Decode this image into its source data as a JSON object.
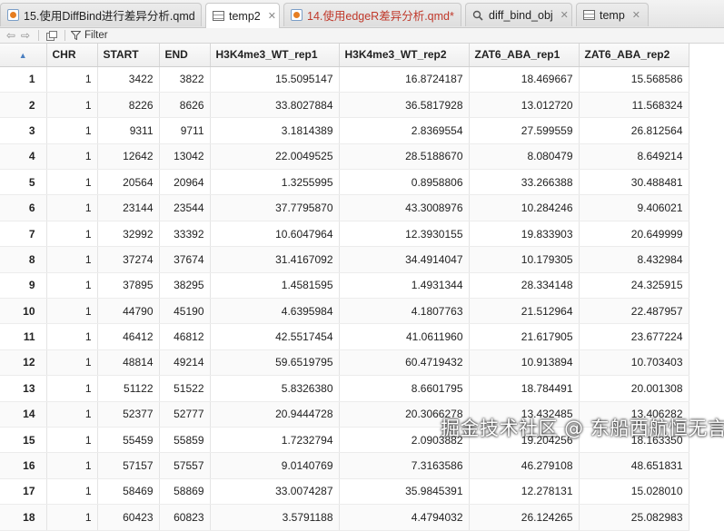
{
  "tabs": [
    {
      "label": "15.使用DiffBind进行差异分析.qmd",
      "icon": "r-doc-icon",
      "active": false,
      "modified": false
    },
    {
      "label": "temp2",
      "icon": "table-icon",
      "active": true,
      "modified": false
    },
    {
      "label": "14.使用edgeR差异分析.qmd*",
      "icon": "r-doc-icon",
      "active": false,
      "modified": true
    },
    {
      "label": "diff_bind_obj",
      "icon": "magnifier-icon",
      "active": false,
      "modified": false
    },
    {
      "label": "temp",
      "icon": "table-icon",
      "active": false,
      "modified": false
    }
  ],
  "toolbar": {
    "filter_label": "Filter"
  },
  "table": {
    "columns": [
      "CHR",
      "START",
      "END",
      "H3K4me3_WT_rep1",
      "H3K4me3_WT_rep2",
      "ZAT6_ABA_rep1",
      "ZAT6_ABA_rep2"
    ],
    "rows": [
      [
        "1",
        "1",
        "3422",
        "3822",
        "15.5095147",
        "16.8724187",
        "18.469667",
        "15.568586"
      ],
      [
        "2",
        "1",
        "8226",
        "8626",
        "33.8027884",
        "36.5817928",
        "13.012720",
        "11.568324"
      ],
      [
        "3",
        "1",
        "9311",
        "9711",
        "3.1814389",
        "2.8369554",
        "27.599559",
        "26.812564"
      ],
      [
        "4",
        "1",
        "12642",
        "13042",
        "22.0049525",
        "28.5188670",
        "8.080479",
        "8.649214"
      ],
      [
        "5",
        "1",
        "20564",
        "20964",
        "1.3255995",
        "0.8958806",
        "33.266388",
        "30.488481"
      ],
      [
        "6",
        "1",
        "23144",
        "23544",
        "37.7795870",
        "43.3008976",
        "10.284246",
        "9.406021"
      ],
      [
        "7",
        "1",
        "32992",
        "33392",
        "10.6047964",
        "12.3930155",
        "19.833903",
        "20.649999"
      ],
      [
        "8",
        "1",
        "37274",
        "37674",
        "31.4167092",
        "34.4914047",
        "10.179305",
        "8.432984"
      ],
      [
        "9",
        "1",
        "37895",
        "38295",
        "1.4581595",
        "1.4931344",
        "28.334148",
        "24.325915"
      ],
      [
        "10",
        "1",
        "44790",
        "45190",
        "4.6395984",
        "4.1807763",
        "21.512964",
        "22.487957"
      ],
      [
        "11",
        "1",
        "46412",
        "46812",
        "42.5517454",
        "41.0611960",
        "21.617905",
        "23.677224"
      ],
      [
        "12",
        "1",
        "48814",
        "49214",
        "59.6519795",
        "60.4719432",
        "10.913894",
        "10.703403"
      ],
      [
        "13",
        "1",
        "51122",
        "51522",
        "5.8326380",
        "8.6601795",
        "18.784491",
        "20.001308"
      ],
      [
        "14",
        "1",
        "52377",
        "52777",
        "20.9444728",
        "20.3066278",
        "13.432485",
        "13.406282"
      ],
      [
        "15",
        "1",
        "55459",
        "55859",
        "1.7232794",
        "2.0903882",
        "19.204256",
        "18.163350"
      ],
      [
        "16",
        "1",
        "57157",
        "57557",
        "9.0140769",
        "7.3163586",
        "46.279108",
        "48.651831"
      ],
      [
        "17",
        "1",
        "58469",
        "58869",
        "33.0074287",
        "35.9845391",
        "12.278131",
        "15.028010"
      ],
      [
        "18",
        "1",
        "60423",
        "60823",
        "3.5791188",
        "4.4794032",
        "26.124265",
        "25.082983"
      ]
    ]
  },
  "watermark": "掘金技术社区 @ 东船西航恒无言"
}
